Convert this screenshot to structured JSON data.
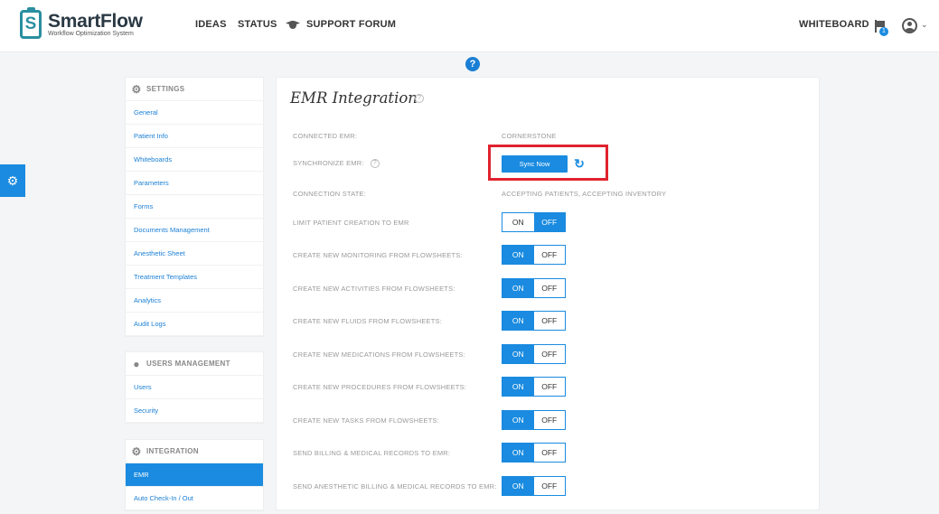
{
  "header": {
    "logo_letter": "S",
    "logo_name": "SmartFlow",
    "logo_tagline": "Workflow Optimization System",
    "nav": {
      "ideas": "IDEAS",
      "status": "STATUS",
      "support_forum": "SUPPORT FORUM",
      "whiteboard": "WHITEBOARD"
    },
    "notification_count": "1"
  },
  "help_glyph": "?",
  "sidebar": {
    "settings": {
      "title": "SETTINGS",
      "items": [
        "General",
        "Patient Info",
        "Whiteboards",
        "Parameters",
        "Forms",
        "Documents Management",
        "Anesthetic Sheet",
        "Treatment Templates",
        "Analytics",
        "Audit Logs"
      ]
    },
    "users": {
      "title": "USERS MANAGEMENT",
      "items": [
        "Users",
        "Security"
      ]
    },
    "integration": {
      "title": "INTEGRATION",
      "items": [
        "EMR",
        "Auto Check-In / Out"
      ],
      "active_index": 0
    }
  },
  "main": {
    "title": "EMR Integration",
    "connected_emr_label": "CONNECTED EMR:",
    "connected_emr_value": "CORNERSTONE",
    "synchronize_label": "SYNCHRONIZE EMR:",
    "sync_button": "Sync Now",
    "connection_state_label": "CONNECTION STATE:",
    "connection_state_value": "ACCEPTING PATIENTS, ACCEPTING INVENTORY",
    "toggle_on_text": "ON",
    "toggle_off_text": "OFF",
    "toggles": [
      {
        "label": "LIMIT PATIENT CREATION TO EMR",
        "state": "off"
      },
      {
        "label": "CREATE NEW MONITORING FROM FLOWSHEETS:",
        "state": "on"
      },
      {
        "label": "CREATE NEW ACTIVITIES FROM FLOWSHEETS:",
        "state": "on"
      },
      {
        "label": "CREATE NEW FLUIDS FROM FLOWSHEETS:",
        "state": "on"
      },
      {
        "label": "CREATE NEW MEDICATIONS FROM FLOWSHEETS:",
        "state": "on"
      },
      {
        "label": "CREATE NEW PROCEDURES FROM FLOWSHEETS:",
        "state": "on"
      },
      {
        "label": "CREATE NEW TASKS FROM FLOWSHEETS:",
        "state": "on"
      },
      {
        "label": "SEND BILLING & MEDICAL RECORDS TO EMR:",
        "state": "on"
      },
      {
        "label": "SEND ANESTHETIC BILLING & MEDICAL RECORDS TO EMR:",
        "state": "on"
      }
    ]
  },
  "colors": {
    "accent": "#1a8be0",
    "highlight": "#e0232e",
    "logo": "#2a8fa0"
  },
  "icons": [
    "graduation-cap-icon",
    "flag-icon",
    "user-icon",
    "chevron-down-icon",
    "help-icon",
    "bug-icon",
    "gear-icon",
    "users-icon",
    "refresh-icon"
  ]
}
